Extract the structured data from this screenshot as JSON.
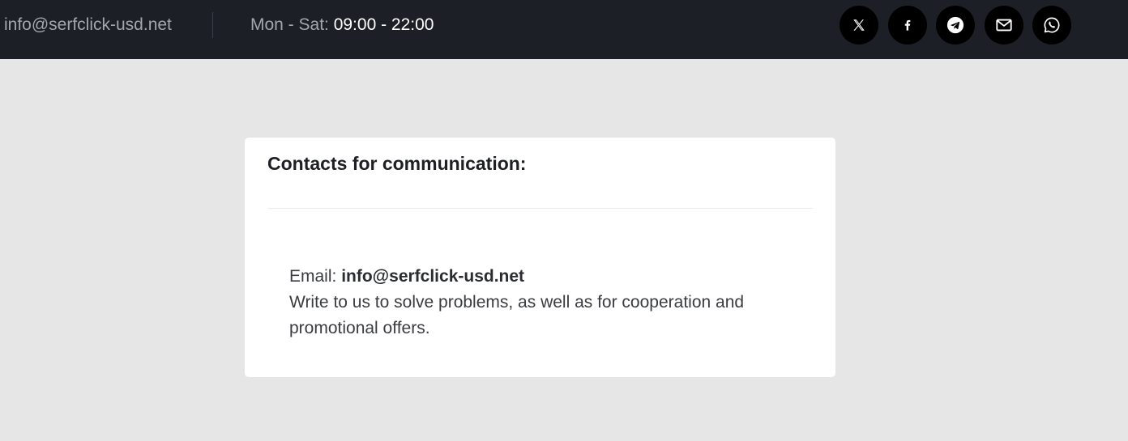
{
  "topbar": {
    "email": "info@serfclick-usd.net",
    "hours_label": "Mon - Sat: ",
    "hours_time": "09:00 - 22:00",
    "social": [
      {
        "icon": "x-icon",
        "label": "X"
      },
      {
        "icon": "facebook-icon",
        "label": "Facebook"
      },
      {
        "icon": "telegram-icon",
        "label": "Telegram"
      },
      {
        "icon": "mail-icon",
        "label": "Email"
      },
      {
        "icon": "whatsapp-icon",
        "label": "WhatsApp"
      }
    ]
  },
  "contacts": {
    "heading": "Contacts for communication:",
    "email_label": "Email: ",
    "email_value": "info@serfclick-usd.net",
    "description": "Write to us to solve problems, as well as for cooperation and promotional offers."
  },
  "colors": {
    "topbar_bg": "#1c1f25",
    "page_bg": "#e6e6e6",
    "card_bg": "#ffffff",
    "icon_bg": "#000000"
  }
}
